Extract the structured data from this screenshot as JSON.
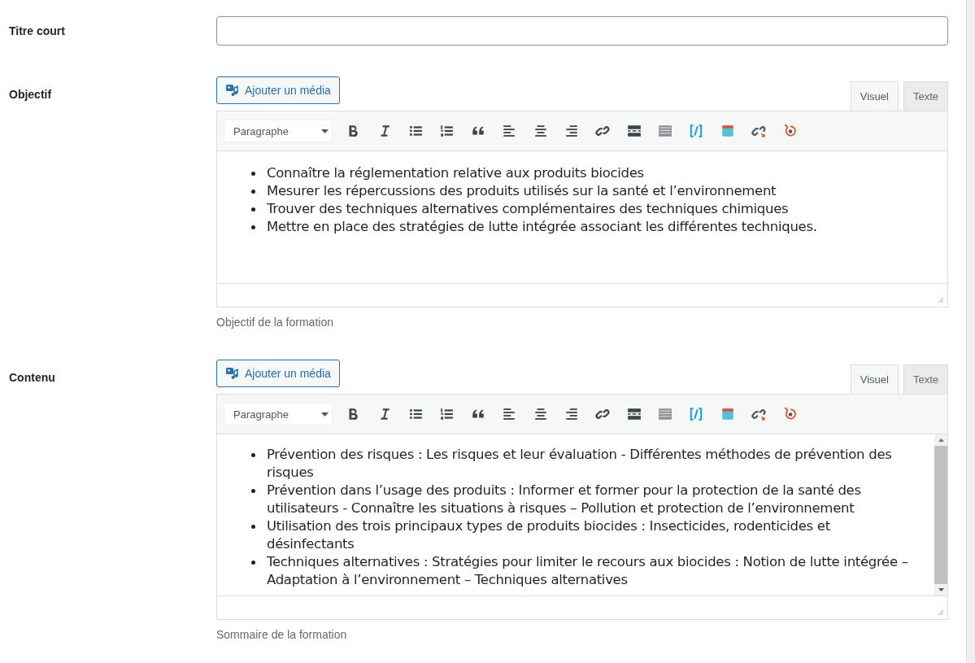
{
  "fields": [
    {
      "kind": "text",
      "label": "Titre court"
    },
    {
      "kind": "editor",
      "label": "Objectif",
      "media_button": "Ajouter un média",
      "tabs": [
        {
          "label": "Visuel",
          "selected": true
        },
        {
          "label": "Texte",
          "selected": false
        }
      ],
      "format": "Paragraphe",
      "scrollable": false,
      "items": [
        "Connaître la réglementation relative aux produits biocides",
        "Mesurer les répercussions des produits utilisés sur la santé et l’environnement",
        "Trouver des techniques alternatives complémentaires des techniques chimiques",
        "Mettre en place des stratégies de lutte intégrée associant les différentes techniques."
      ],
      "description": "Objectif de la formation"
    },
    {
      "kind": "editor",
      "label": "Contenu",
      "media_button": "Ajouter un média",
      "tabs": [
        {
          "label": "Visuel",
          "selected": true
        },
        {
          "label": "Texte",
          "selected": false
        }
      ],
      "format": "Paragraphe",
      "scrollable": true,
      "items": [
        "Prévention des risques : Les risques et leur évaluation - Différentes méthodes de prévention des risques",
        "Prévention dans l’usage des produits : Informer et former pour la protection de la santé des utilisateurs - Connaître les situations à risques – Pollution et protection de l’environnement",
        "Utilisation des trois principaux types de produits biocides : Insecticides, rodenticides et désinfectants",
        "Techniques alternatives : Stratégies pour limiter le recours aux biocides : Notion de lutte intégrée – Adaptation à l’environnement – Techniques alternatives"
      ],
      "description": "Sommaire de la formation"
    }
  ]
}
